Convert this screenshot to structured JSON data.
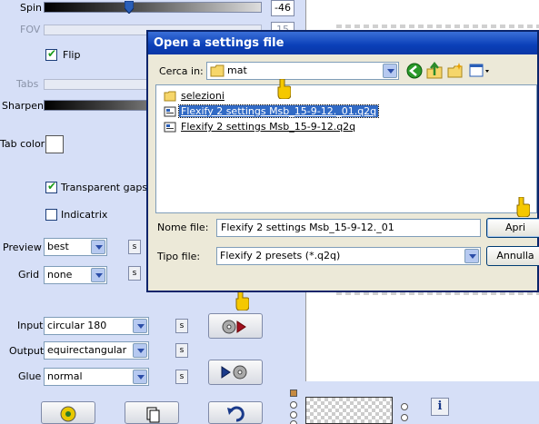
{
  "panel": {
    "spin": {
      "label": "Spin",
      "value": "-46"
    },
    "fov": {
      "label": "FOV",
      "value": "15"
    },
    "flip": {
      "label": "Flip",
      "checked": true
    },
    "tabs": {
      "label": "Tabs"
    },
    "sharpen": {
      "label": "Sharpen"
    },
    "tab_color": {
      "label": "Tab color",
      "color": "#ffffff"
    },
    "transparent_gaps": {
      "label": "Transparent gaps",
      "checked": true
    },
    "indicatrix": {
      "label": "Indicatrix",
      "checked": false
    },
    "preview": {
      "label": "Preview",
      "value": "best"
    },
    "grid": {
      "label": "Grid",
      "value": "none"
    },
    "input": {
      "label": "Input",
      "value": "circular 180"
    },
    "output": {
      "label": "Output",
      "value": "equirectangular"
    },
    "glue": {
      "label": "Glue",
      "value": "normal"
    },
    "s_label": "s",
    "info_label": "i"
  },
  "dialog": {
    "title": "Open a settings file",
    "lookin_label": "Cerca in:",
    "lookin_value": "mat",
    "files": [
      {
        "name": "selezioni",
        "type": "folder",
        "selected": false
      },
      {
        "name": "Flexify 2 settings Msb_15-9-12._01.q2q",
        "type": "file",
        "selected": true
      },
      {
        "name": "Flexify 2 settings Msb_15-9-12.q2q",
        "type": "file",
        "selected": false
      }
    ],
    "filename_label": "Nome file:",
    "filename_value": "Flexify 2 settings Msb_15-9-12._01",
    "filetype_label": "Tipo file:",
    "filetype_value": "Flexify 2 presets (*.q2q)",
    "open_button": "Apri",
    "cancel_button": "Annulla"
  },
  "colors": {
    "panel_bg": "#d6dff7",
    "dialog_bg": "#ece9d8",
    "titlebar": "#0a3fb8",
    "selection": "#316ac5"
  }
}
